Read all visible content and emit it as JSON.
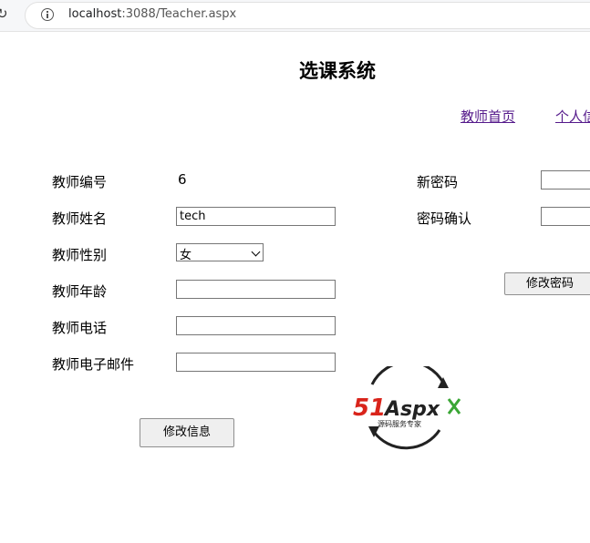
{
  "browser": {
    "url_host": "localhost",
    "url_rest": ":3088/Teacher.aspx"
  },
  "page": {
    "title": "选课系统"
  },
  "nav": {
    "home": "教师首页",
    "personal": "个人信"
  },
  "form": {
    "id_label": "教师编号",
    "id_value": "6",
    "name_label": "教师姓名",
    "name_value": "tech",
    "gender_label": "教师性别",
    "gender_value": "女",
    "age_label": "教师年龄",
    "age_value": "",
    "phone_label": "教师电话",
    "phone_value": "",
    "email_label": "教师电子邮件",
    "email_value": "",
    "save_button": "修改信息"
  },
  "password": {
    "new_label": "新密码",
    "confirm_label": "密码确认",
    "button": "修改密码"
  },
  "logo": {
    "text_51": "51",
    "text_aspx": "Aspx",
    "tagline": "源码服务专家",
    "color_red": "#d9241b",
    "color_dark": "#222222",
    "color_green": "#3aa635"
  }
}
